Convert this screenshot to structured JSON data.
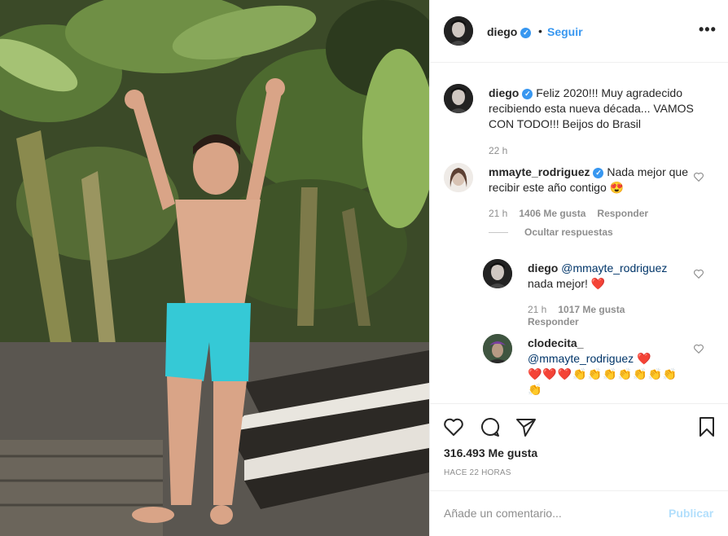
{
  "post": {
    "author": "diego",
    "follow_label": "Seguir",
    "dot": "•",
    "more": "•••"
  },
  "caption": {
    "user": "diego",
    "text": "Feliz 2020!!! Muy agradecido recibiendo esta nueva década... VAMOS CON TODO!!! Beijos do Brasil",
    "time": "22 h"
  },
  "comments": [
    {
      "user": "mmayte_rodriguez",
      "text": "Nada mejor que recibir este año contigo 😍",
      "time": "21 h",
      "likes": "1406 Me gusta",
      "reply": "Responder",
      "hide_replies": "Ocultar respuestas"
    },
    {
      "user": "diego",
      "mention": "@mmayte_rodriguez",
      "text": "nada mejor! ❤️",
      "time": "21 h",
      "likes": "1017 Me gusta",
      "reply": "Responder"
    },
    {
      "user": "clodecita_",
      "mention": "@mmayte_rodriguez",
      "text": "❤️",
      "emojis": "❤️❤️❤️👏👏👏👏👏👏👏👏"
    }
  ],
  "stats": {
    "likes": "316.493 Me gusta",
    "posted": "HACE 22 HORAS"
  },
  "composer": {
    "placeholder": "Añade un comentario...",
    "publish": "Publicar"
  },
  "icons": {
    "verified": "verified-badge-icon",
    "like": "heart-icon",
    "comment": "comment-bubble-icon",
    "share": "paper-plane-icon",
    "save": "bookmark-icon"
  },
  "colors": {
    "accent": "#3897f0",
    "publish_disabled": "#b2dffc",
    "meta": "#8e8e8e",
    "heart": "#e0245e"
  }
}
